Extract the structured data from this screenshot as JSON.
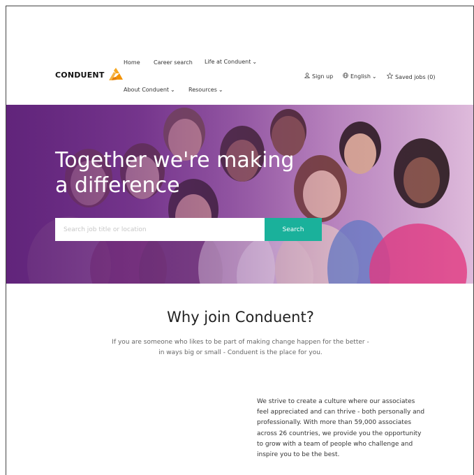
{
  "brand": {
    "name": "CONDUENT",
    "accent": "#f7a823"
  },
  "nav": {
    "home": "Home",
    "career_search": "Career search",
    "life_at": "Life at Conduent",
    "about": "About Conduent",
    "resources": "Resources"
  },
  "utility": {
    "sign_up": "Sign up",
    "language": "English",
    "saved_jobs": "Saved jobs (0)"
  },
  "hero": {
    "title_line1": "Together we're making",
    "title_line2": "a difference",
    "search_placeholder": "Search job title or location",
    "search_button": "Search",
    "button_color": "#1ab19b"
  },
  "why": {
    "title": "Why join Conduent?",
    "subtitle_line1": "If you are someone who likes to be part of making change happen for the better -",
    "subtitle_line2": "in ways big or small - Conduent is the place for you.",
    "body": "We strive to create a culture where our associates feel appreciated and can thrive - both personally and professionally. With more than 59,000 associates across 26 countries, we provide you the opportunity to grow with a team of people who challenge and inspire you to be the best."
  }
}
